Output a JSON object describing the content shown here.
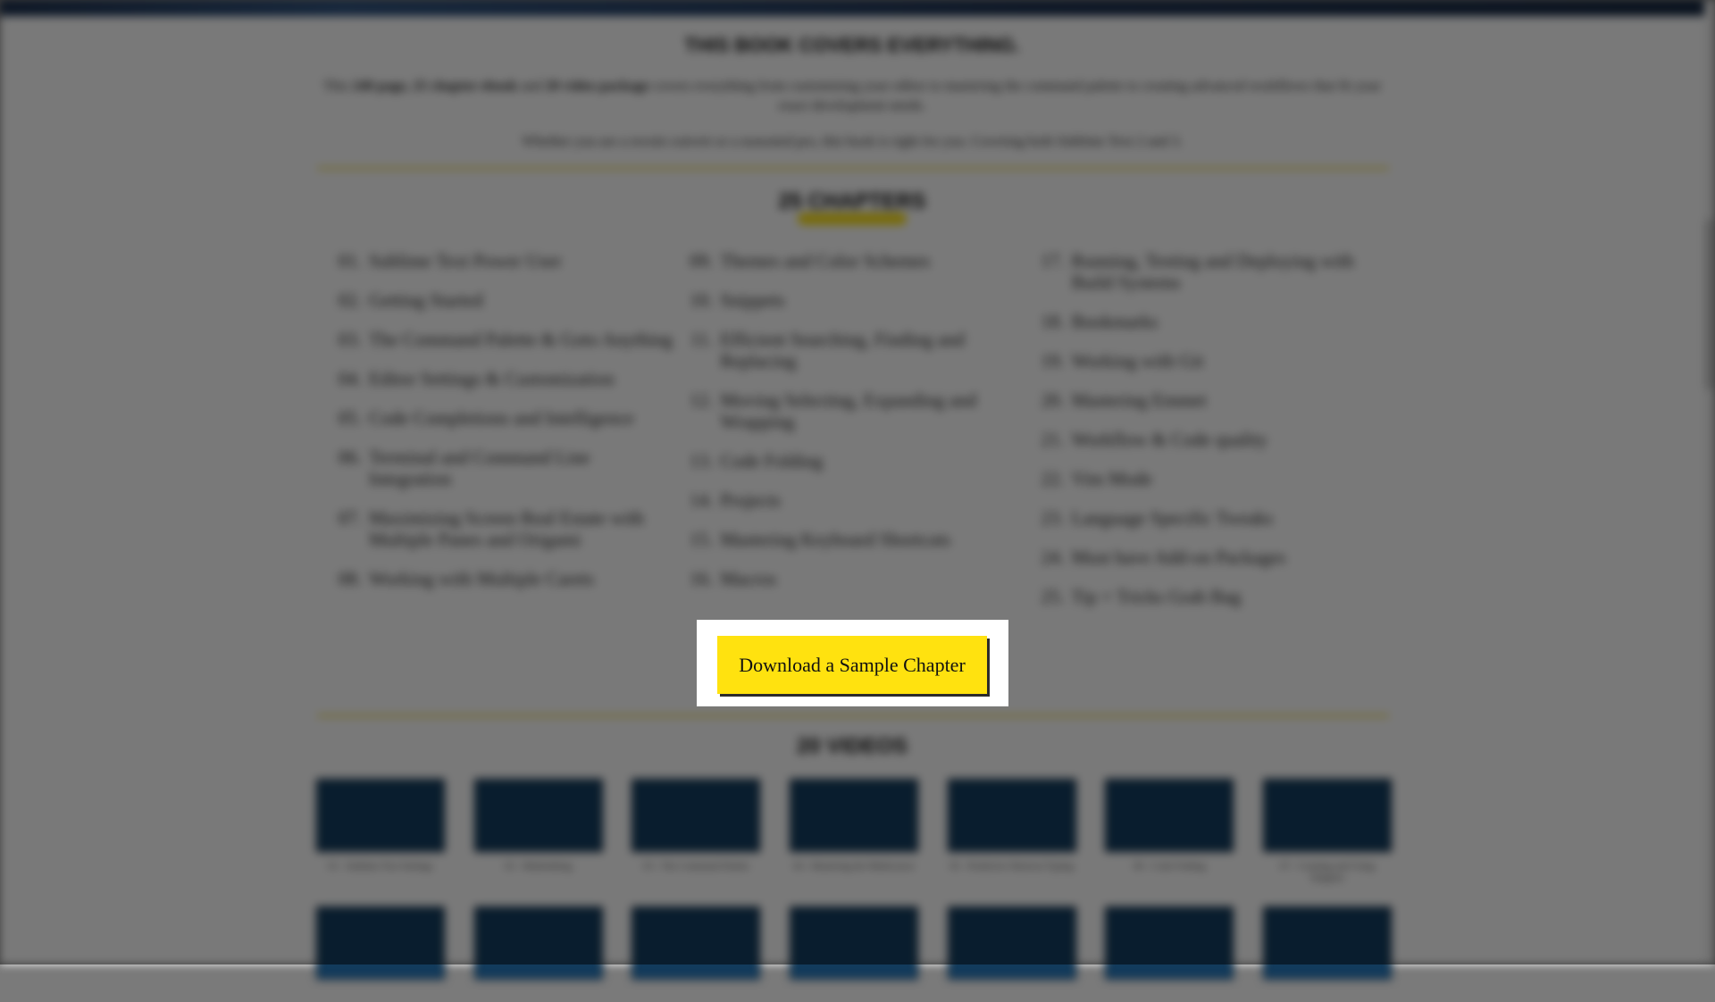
{
  "header": {
    "title": "THIS BOOK COVERS EVERYTHING.",
    "intro_prefix": "This ",
    "intro_bold_1": "240 page, 25 chapter ebook",
    "intro_mid": " and ",
    "intro_bold_2": "20 video package",
    "intro_suffix": " covers everything from customizing your editor to mastering the command palette to creating advanced workflows that fit your exact development needs.",
    "subline": "Whether you are a recent convert or a seasoned pro, this book is right for you. Covering both Sublime Text 2 and 3."
  },
  "chapters": {
    "title": "25 CHAPTERS",
    "columns": [
      [
        {
          "num": "01.",
          "title": "Sublime Text Power User"
        },
        {
          "num": "02.",
          "title": "Getting Started"
        },
        {
          "num": "03.",
          "title": "The Command Palette & Goto Anything"
        },
        {
          "num": "04.",
          "title": "Editor Settings & Customization"
        },
        {
          "num": "05.",
          "title": "Code Completions and Intelligence"
        },
        {
          "num": "06.",
          "title": "Terminal and Command Line Integration"
        },
        {
          "num": "07.",
          "title": "Maximizing Screen Real Estate with Multiple Panes and Origami"
        },
        {
          "num": "08.",
          "title": "Working with Multiple Carets"
        }
      ],
      [
        {
          "num": "09.",
          "title": "Themes and Color Schemes"
        },
        {
          "num": "10.",
          "title": "Snippets"
        },
        {
          "num": "11.",
          "title": "Efficient Searching, Finding and Replacing"
        },
        {
          "num": "12.",
          "title": "Moving Selecting, Expanding and Wrapping"
        },
        {
          "num": "13.",
          "title": "Code Folding"
        },
        {
          "num": "14.",
          "title": "Projects"
        },
        {
          "num": "15.",
          "title": "Mastering Keyboard Shortcuts"
        },
        {
          "num": "16.",
          "title": "Macros"
        }
      ],
      [
        {
          "num": "17.",
          "title": "Running, Testing and Deploying with Build Systems"
        },
        {
          "num": "18.",
          "title": "Bookmarks"
        },
        {
          "num": "19.",
          "title": "Working with Git"
        },
        {
          "num": "20.",
          "title": "Mastering Emmet"
        },
        {
          "num": "21.",
          "title": "Workflow & Code quality"
        },
        {
          "num": "22.",
          "title": "Vim Mode"
        },
        {
          "num": "23.",
          "title": "Language Specific Tweaks"
        },
        {
          "num": "24.",
          "title": "Must have Add-on Packages"
        },
        {
          "num": "25.",
          "title": "Tip + Tricks Grab Bag"
        }
      ]
    ]
  },
  "cta": {
    "label": "Download a Sample Chapter"
  },
  "videos": {
    "title": "20 VIDEOS",
    "row1": [
      {
        "caption": "01 - Sublime Text Settings"
      },
      {
        "caption": "02 - Multiediting"
      },
      {
        "caption": "03 - The Command Palette"
      },
      {
        "caption": "04 - Mastering the Multicursor"
      },
      {
        "caption": "05 - Predictive Shortcut Typing"
      },
      {
        "caption": "06 - Code Folding"
      },
      {
        "caption": "07 - Creating and Using Snippets"
      }
    ],
    "row2": [
      {
        "caption": ""
      },
      {
        "caption": ""
      },
      {
        "caption": ""
      },
      {
        "caption": ""
      },
      {
        "caption": ""
      },
      {
        "caption": ""
      },
      {
        "caption": ""
      }
    ]
  },
  "colors": {
    "accent": "#ffe20f",
    "thumb": "#123b5c",
    "overlay": "rgba(0,0,0,0.5)"
  }
}
